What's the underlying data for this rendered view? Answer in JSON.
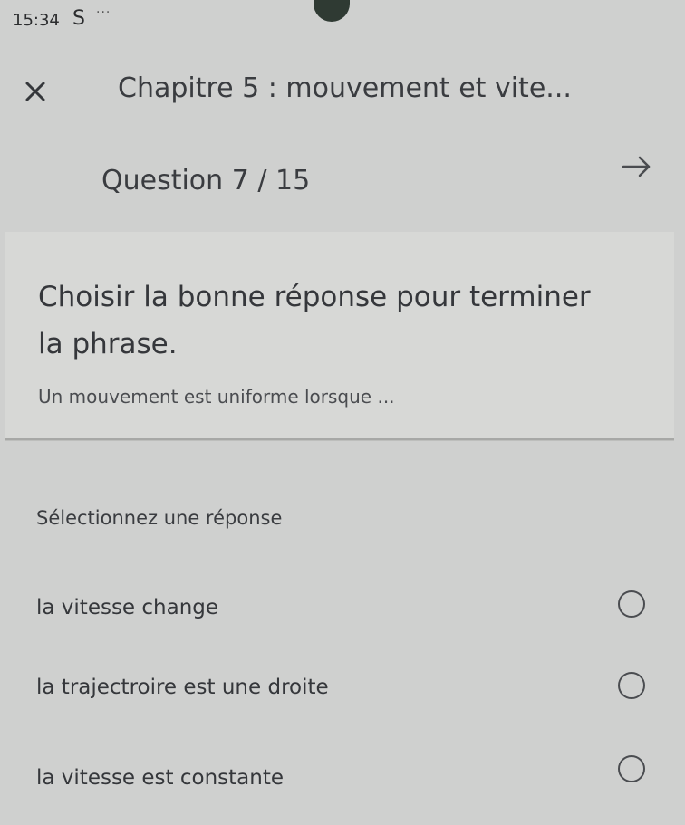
{
  "status_bar": {
    "time": "15:34",
    "app_letter": "S",
    "more": "···"
  },
  "header": {
    "chapter_title": "Chapitre 5 : mouvement et vite...",
    "question_counter": "Question 7 / 15"
  },
  "question": {
    "prompt": "Choisir la bonne réponse pour terminer la phrase.",
    "sentence": "Un mouvement est uniforme lorsque ..."
  },
  "answers": {
    "instruction": "Sélectionnez une réponse",
    "options": [
      {
        "label": "la vitesse change",
        "selected": false
      },
      {
        "label": "la trajectroire est une droite",
        "selected": false
      },
      {
        "label": "la vitesse est constante",
        "selected": false
      }
    ]
  },
  "icons": {
    "close": "close-icon",
    "next": "arrow-right-icon",
    "radio": "radio-unchecked-icon"
  }
}
